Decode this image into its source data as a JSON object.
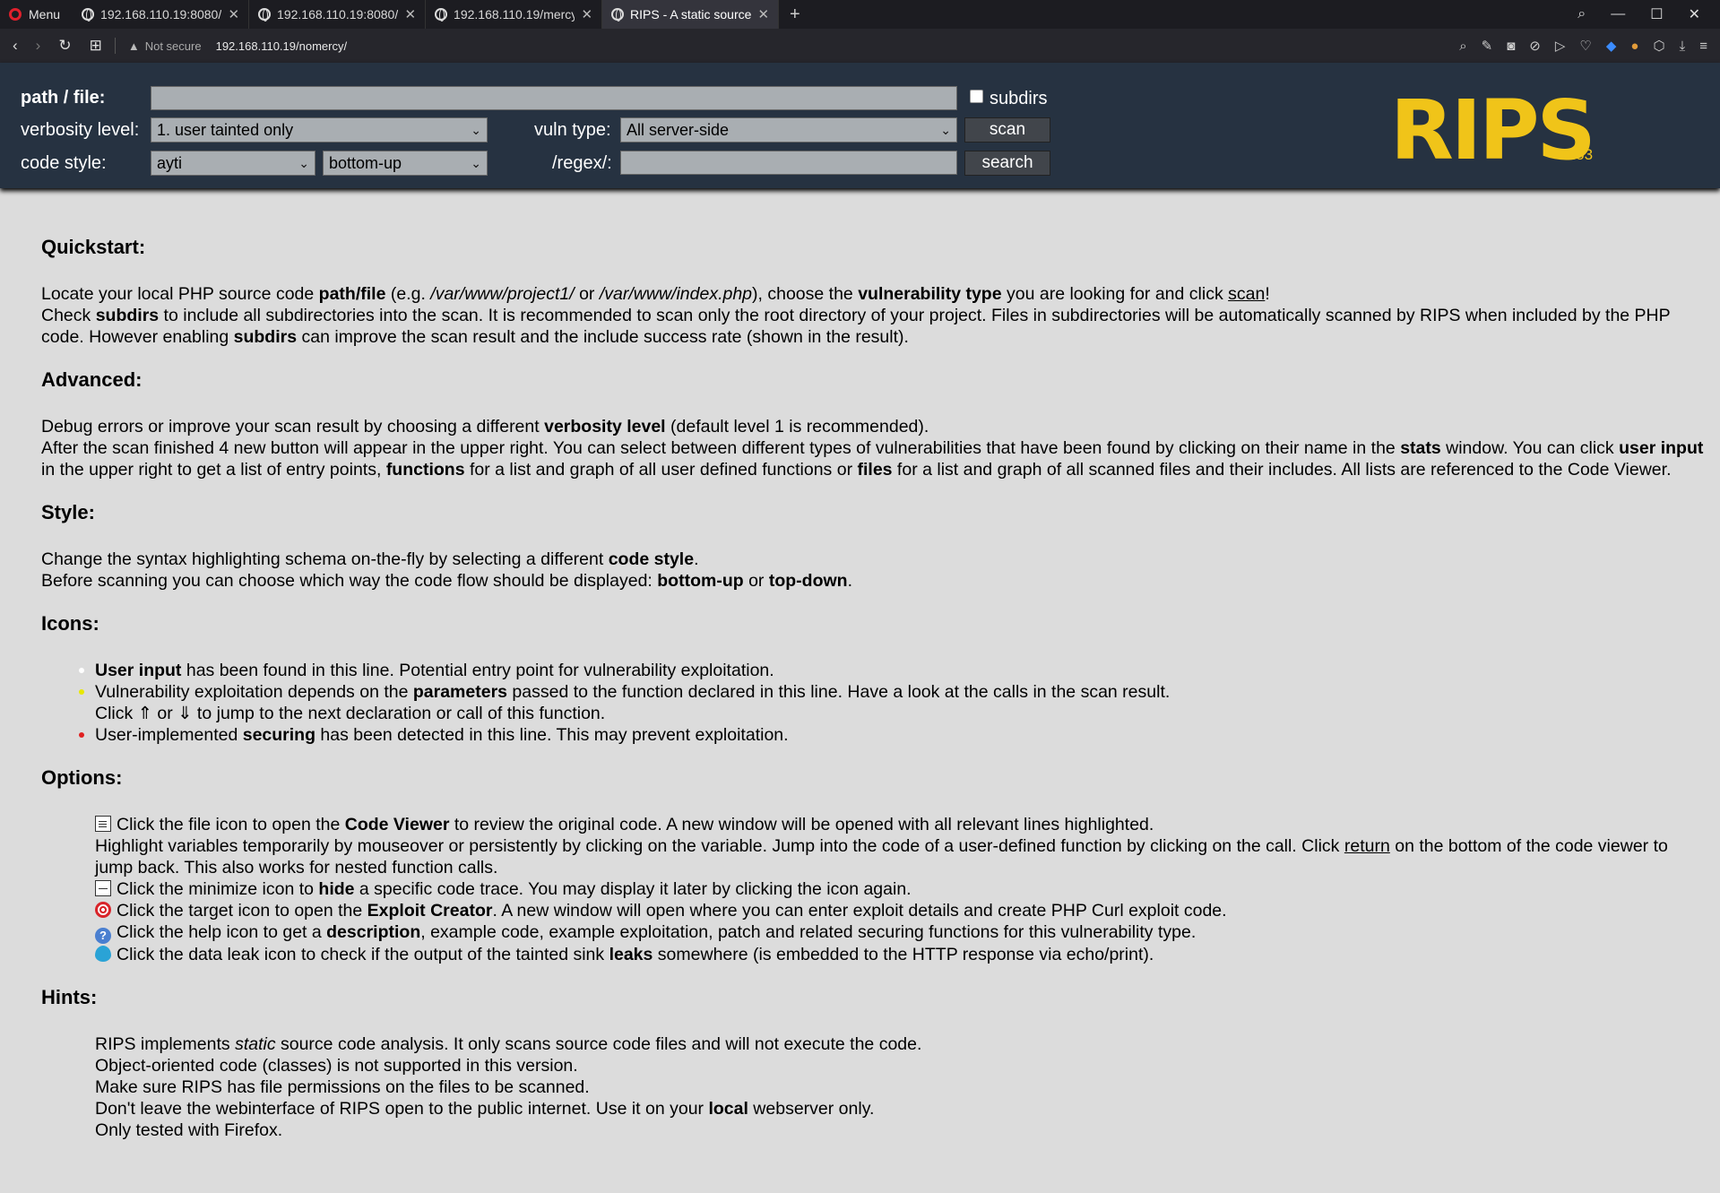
{
  "browser": {
    "menu_label": "Menu",
    "tabs": [
      {
        "title": "192.168.110.19:8080/"
      },
      {
        "title": "192.168.110.19:8080/"
      },
      {
        "title": "192.168.110.19/mercy"
      },
      {
        "title": "RIPS - A static source"
      }
    ],
    "not_secure": "Not secure",
    "url": "192.168.110.19/nomercy/"
  },
  "rips": {
    "path_label": "path / file:",
    "path_value": "",
    "subdirs_label": "subdirs",
    "verbosity_label": "verbosity level:",
    "verbosity_value": "1. user tainted only",
    "vuln_label": "vuln type:",
    "vuln_value": "All server-side",
    "scan_label": "scan",
    "code_style_label": "code style:",
    "code_style_value": "ayti",
    "flow_value": "bottom-up",
    "regex_label": "/regex/:",
    "regex_value": "",
    "search_label": "search",
    "logo_text": "RIPS",
    "version": "0.53"
  },
  "content": {
    "quickstart": {
      "heading": "Quickstart:",
      "l1_a": "Locate your local PHP source code ",
      "l1_b": "path/file",
      "l1_c": " (e.g. ",
      "l1_d": "/var/www/project1/",
      "l1_e": " or ",
      "l1_f": "/var/www/index.php",
      "l1_g": "), choose the ",
      "l1_h": "vulnerability type",
      "l1_i": " you are looking for and click ",
      "l1_j": "scan",
      "l1_k": "!",
      "l2_a": "Check ",
      "l2_b": "subdirs",
      "l2_c": " to include all subdirectories into the scan. It is recommended to scan only the root directory of your project. Files in subdirectories will be automatically scanned by RIPS when included by the PHP code. However enabling ",
      "l2_d": "subdirs",
      "l2_e": " can improve the scan result and the include success rate (shown in the result)."
    },
    "advanced": {
      "heading": "Advanced:",
      "l1_a": "Debug errors or improve your scan result by choosing a different ",
      "l1_b": "verbosity level",
      "l1_c": " (default level 1 is recommended).",
      "l2_a": "After the scan finished 4 new button will appear in the upper right. You can select between different types of vulnerabilities that have been found by clicking on their name in the ",
      "l2_b": "stats",
      "l2_c": " window. You can click ",
      "l2_d": "user input",
      "l2_e": " in the upper right to get a list of entry points, ",
      "l2_f": "functions",
      "l2_g": " for a list and graph of all user defined functions or ",
      "l2_h": "files",
      "l2_i": " for a list and graph of all scanned files and their includes. All lists are referenced to the Code Viewer."
    },
    "style": {
      "heading": "Style:",
      "l1_a": "Change the syntax highlighting schema on-the-fly by selecting a different ",
      "l1_b": "code style",
      "l1_c": ".",
      "l2_a": "Before scanning you can choose which way the code flow should be displayed: ",
      "l2_b": "bottom-up",
      "l2_c": " or ",
      "l2_d": "top-down",
      "l2_e": "."
    },
    "icons": {
      "heading": "Icons:",
      "i1_a": "User input",
      "i1_b": " has been found in this line. Potential entry point for vulnerability exploitation.",
      "i2_a": "Vulnerability exploitation depends on the ",
      "i2_b": "parameters",
      "i2_c": " passed to the function declared in this line. Have a look at the calls in the scan result.",
      "i2_d": "Click ⇑ or ⇓ to jump to the next declaration or call of this function.",
      "i3_a": "User-implemented ",
      "i3_b": "securing",
      "i3_c": " has been detected in this line. This may prevent exploitation.",
      "dot_colors": [
        "#ffffff",
        "#e8e800",
        "#e02020"
      ]
    },
    "options": {
      "heading": "Options:",
      "o1_a": "Click the file icon to open the ",
      "o1_b": "Code Viewer",
      "o1_c": " to review the original code. A new window will be opened with all relevant lines highlighted.",
      "o1_d": "Highlight variables temporarily by mouseover or persistently by clicking on the variable. Jump into the code of a user-defined function by clicking on the call. Click ",
      "o1_e": "return",
      "o1_f": " on the bottom of the code viewer to jump back. This also works for nested function calls.",
      "o2_a": "Click the minimize icon to ",
      "o2_b": "hide",
      "o2_c": " a specific code trace. You may display it later by clicking the icon again.",
      "o3_a": "Click the target icon to open the ",
      "o3_b": "Exploit Creator",
      "o3_c": ". A new window will open where you can enter exploit details and create PHP Curl exploit code.",
      "o4_a": "Click the help icon to get a ",
      "o4_b": "description",
      "o4_c": ", example code, example exploitation, patch and related securing functions for this vulnerability type.",
      "o5_a": "Click the data leak icon to check if the output of the tainted sink ",
      "o5_b": "leaks",
      "o5_c": " somewhere (is embedded to the HTTP response via echo/print)."
    },
    "hints": {
      "heading": "Hints:",
      "h1_a": "RIPS implements ",
      "h1_b": "static",
      "h1_c": " source code analysis. It only scans source code files and will not execute the code.",
      "h2": "Object-oriented code (classes) is not supported in this version.",
      "h3": "Make sure RIPS has file permissions on the files to be scanned.",
      "h4_a": "Don't leave the webinterface of RIPS open to the public internet. Use it on your ",
      "h4_b": "local",
      "h4_c": " webserver only.",
      "h5": "Only tested with Firefox."
    }
  }
}
